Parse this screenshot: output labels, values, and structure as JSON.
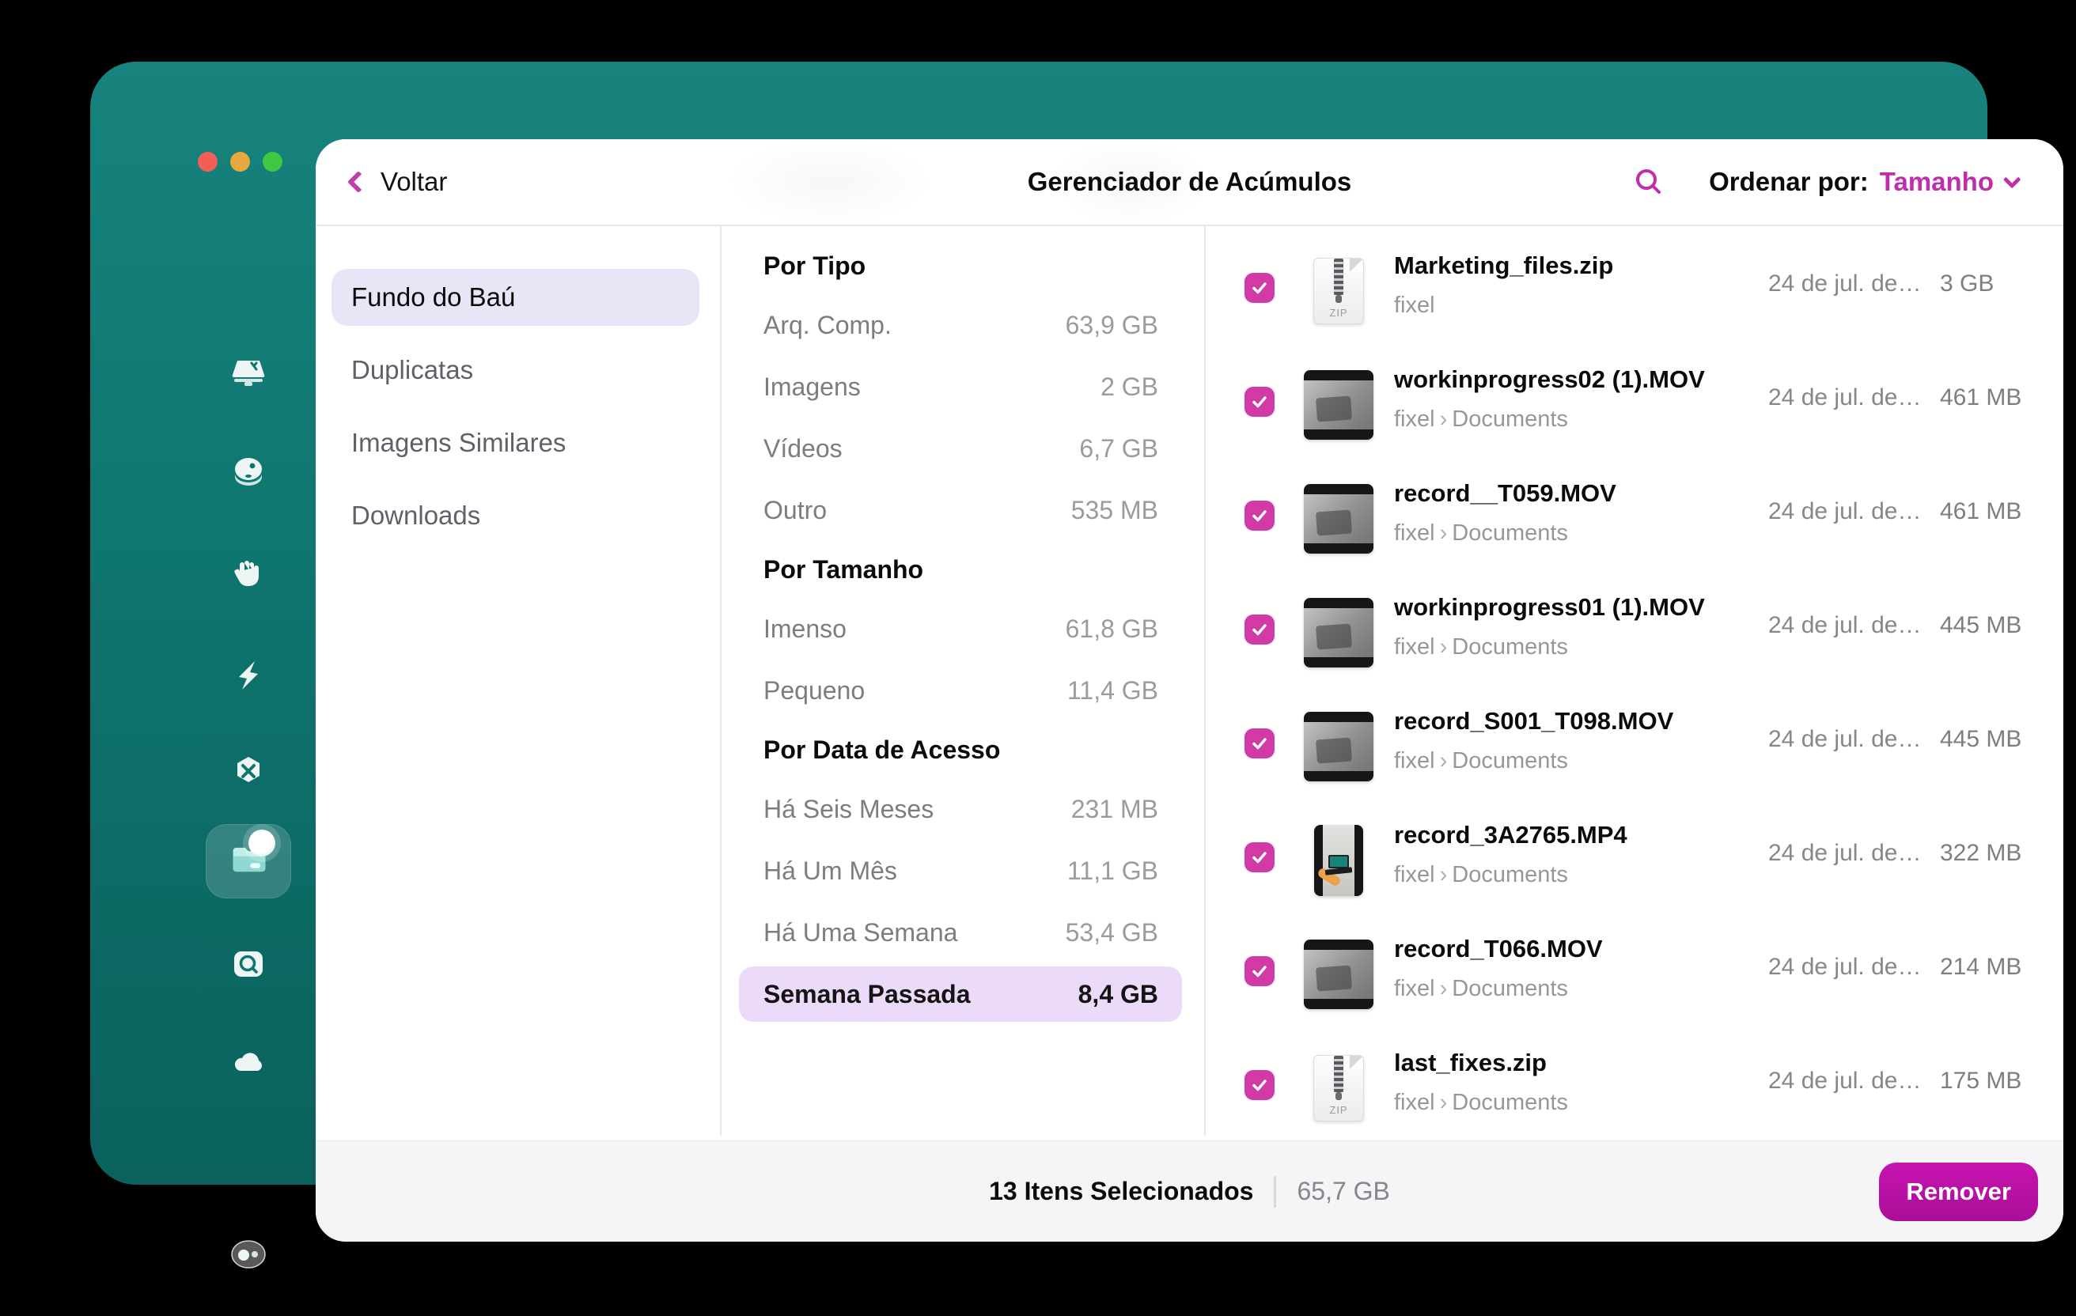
{
  "header": {
    "back_label": "Voltar",
    "title": "Gerenciador de Acúmulos",
    "sort_label": "Ordenar por:",
    "sort_value": "Tamanho"
  },
  "sidebar": {
    "icons": [
      "display-scan-icon",
      "robot-head-icon",
      "hand-icon",
      "lightning-icon",
      "hexagon-tools-icon",
      "folder-icon",
      "magnifier-disk-icon",
      "cloud-icon",
      "assistant-avatar-icon"
    ],
    "active_icon": "folder-icon"
  },
  "nav": {
    "items": [
      {
        "label": "Fundo do Baú",
        "selected": true
      },
      {
        "label": "Duplicatas",
        "selected": false
      },
      {
        "label": "Imagens Similares",
        "selected": false
      },
      {
        "label": "Downloads",
        "selected": false
      }
    ]
  },
  "filters": {
    "sections": [
      {
        "title": "Por Tipo",
        "rows": [
          {
            "label": "Arq. Comp.",
            "value": "63,9 GB",
            "selected": false
          },
          {
            "label": "Imagens",
            "value": "2 GB",
            "selected": false
          },
          {
            "label": "Vídeos",
            "value": "6,7 GB",
            "selected": false
          },
          {
            "label": "Outro",
            "value": "535 MB",
            "selected": false
          }
        ]
      },
      {
        "title": "Por Tamanho",
        "rows": [
          {
            "label": "Imenso",
            "value": "61,8 GB",
            "selected": false
          },
          {
            "label": "Pequeno",
            "value": "11,4 GB",
            "selected": false
          }
        ]
      },
      {
        "title": "Por Data de Acesso",
        "rows": [
          {
            "label": "Há Seis Meses",
            "value": "231 MB",
            "selected": false
          },
          {
            "label": "Há Um Mês",
            "value": "11,1 GB",
            "selected": false
          },
          {
            "label": "Há Uma Semana",
            "value": "53,4 GB",
            "selected": false
          },
          {
            "label": "Semana Passada",
            "value": "8,4 GB",
            "selected": true
          }
        ]
      }
    ]
  },
  "files": {
    "zip_badge": "ZIP",
    "path_separator": "›",
    "rows": [
      {
        "name": "Marketing_files.zip",
        "path": [
          "fixel"
        ],
        "date": "24 de jul. de…",
        "size": "3 GB",
        "checked": true,
        "type": "zip"
      },
      {
        "name": "workinprogress02 (1).MOV",
        "path": [
          "fixel",
          "Documents"
        ],
        "date": "24 de jul. de…",
        "size": "461 MB",
        "checked": true,
        "type": "video"
      },
      {
        "name": "record__T059.MOV",
        "path": [
          "fixel",
          "Documents"
        ],
        "date": "24 de jul. de…",
        "size": "461 MB",
        "checked": true,
        "type": "video"
      },
      {
        "name": "workinprogress01 (1).MOV",
        "path": [
          "fixel",
          "Documents"
        ],
        "date": "24 de jul. de…",
        "size": "445 MB",
        "checked": true,
        "type": "video"
      },
      {
        "name": "record_S001_T098.MOV",
        "path": [
          "fixel",
          "Documents"
        ],
        "date": "24 de jul. de…",
        "size": "445 MB",
        "checked": true,
        "type": "video"
      },
      {
        "name": "record_3A2765.MP4",
        "path": [
          "fixel",
          "Documents"
        ],
        "date": "24 de jul. de…",
        "size": "322 MB",
        "checked": true,
        "type": "video-portrait"
      },
      {
        "name": "record_T066.MOV",
        "path": [
          "fixel",
          "Documents"
        ],
        "date": "24 de jul. de…",
        "size": "214 MB",
        "checked": true,
        "type": "video"
      },
      {
        "name": "last_fixes.zip",
        "path": [
          "fixel",
          "Documents"
        ],
        "date": "24 de jul. de…",
        "size": "175 MB",
        "checked": true,
        "type": "zip"
      }
    ]
  },
  "footer": {
    "selected_count": "13 Itens Selecionados",
    "total_size": "65,7 GB",
    "remove_label": "Remover"
  },
  "colors": {
    "accent_magenta": "#c02fa9",
    "checkbox_magenta": "#d13ba8",
    "remove_button": "#bc10a9",
    "frame_teal": "#0f756f",
    "nav_selected_bg": "#e9e4f6",
    "filter_selected_bg": "#ecdbf8"
  }
}
